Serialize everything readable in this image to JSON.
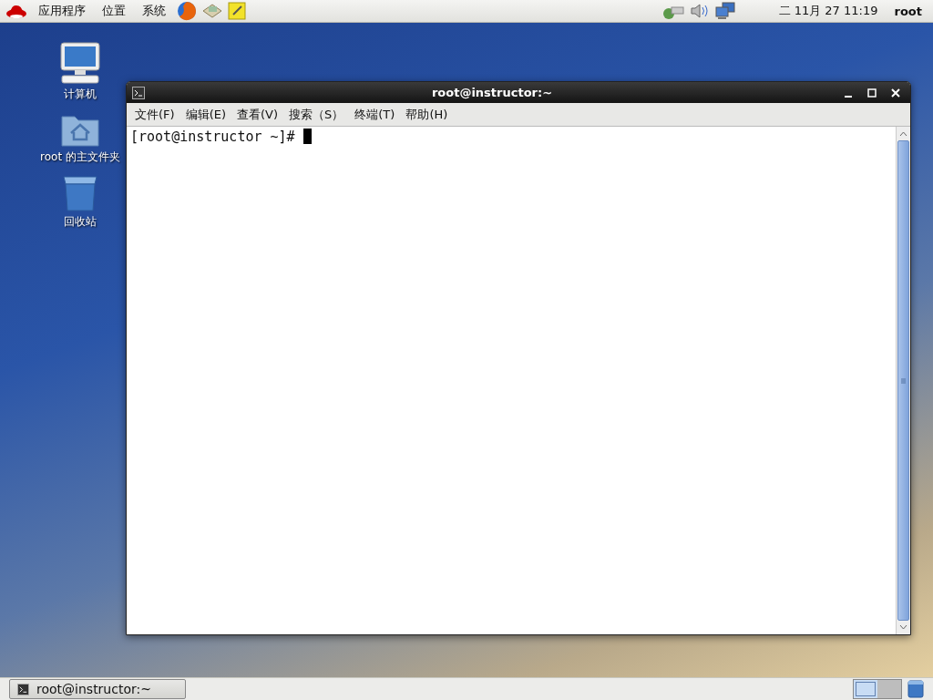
{
  "top_panel": {
    "menus": [
      "应用程序",
      "位置",
      "系统"
    ],
    "clock": "二 11月 27 11:19",
    "user": "root"
  },
  "desktop_icons": [
    {
      "kind": "computer",
      "label": "计算机"
    },
    {
      "kind": "home",
      "label": "root 的主文件夹"
    },
    {
      "kind": "trash",
      "label": "回收站"
    }
  ],
  "terminal": {
    "title": "root@instructor:~",
    "menu": [
      "文件(F)",
      "编辑(E)",
      "查看(V)",
      "搜索（S）",
      "终端(T)",
      "帮助(H)"
    ],
    "prompt": "[root@instructor ~]# "
  },
  "taskbar": {
    "tasks": [
      {
        "label": "root@instructor:~",
        "selected": false
      }
    ],
    "workspaces": [
      {
        "selected": true
      },
      {
        "selected": false
      }
    ]
  }
}
